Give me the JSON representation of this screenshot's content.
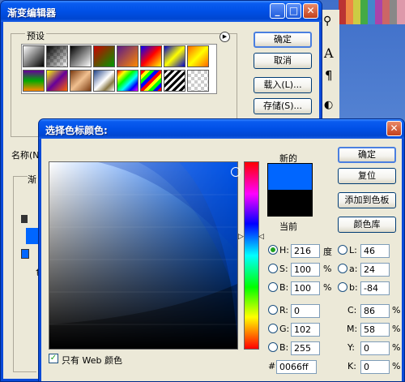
{
  "gradient_editor": {
    "title": "渐变编辑器",
    "presets_label": "预设",
    "ok": "确定",
    "cancel": "取消",
    "load": "载入(L)...",
    "save": "存储(S)...",
    "name_label": "名称(N",
    "type_label": "渐",
    "section_label": "色"
  },
  "color_picker": {
    "title": "选择色标颜色:",
    "new_label": "新的",
    "current_label": "当前",
    "new_color": "#0066ff",
    "current_color": "#000000",
    "ok": "确定",
    "reset": "复位",
    "add_to_swatches": "添加到色板",
    "color_libraries": "颜色库",
    "fields": {
      "H": {
        "label": "H:",
        "value": "216",
        "unit": "度"
      },
      "S": {
        "label": "S:",
        "value": "100",
        "unit": "%"
      },
      "Bv": {
        "label": "B:",
        "value": "100",
        "unit": "%"
      },
      "R": {
        "label": "R:",
        "value": "0"
      },
      "G": {
        "label": "G:",
        "value": "102"
      },
      "Bc": {
        "label": "B:",
        "value": "255"
      },
      "L": {
        "label": "L:",
        "value": "46"
      },
      "a": {
        "label": "a:",
        "value": "24"
      },
      "b": {
        "label": "b:",
        "value": "-84"
      },
      "C": {
        "label": "C:",
        "value": "86",
        "unit": "%"
      },
      "M": {
        "label": "M:",
        "value": "58",
        "unit": "%"
      },
      "Y": {
        "label": "Y:",
        "value": "0",
        "unit": "%"
      },
      "K": {
        "label": "K:",
        "value": "0",
        "unit": "%"
      }
    },
    "hex_label": "#",
    "hex_value": "0066ff",
    "web_only_label": "只有 Web 颜色",
    "web_only_checked": true
  },
  "toolbox_icons": [
    "eyedropper-icon",
    "type-icon",
    "pen-icon",
    "pie-icon"
  ]
}
